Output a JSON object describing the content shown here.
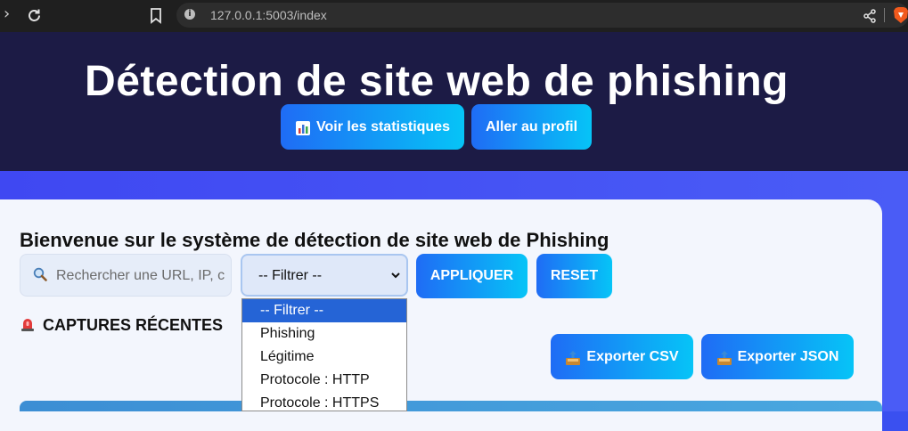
{
  "browser": {
    "url": "127.0.0.1:5003/index"
  },
  "header": {
    "title": "Détection de site web de phishing",
    "stats_button": "Voir les statistiques",
    "profile_button": "Aller au profil"
  },
  "main": {
    "welcome": "Bienvenue sur le système de détection de site web de Phishing",
    "search_placeholder": "Rechercher une URL, IP, c",
    "filter_selected": "-- Filtrer --",
    "apply_button": "APPLIQUER",
    "reset_button": "RESET",
    "section_title": "CAPTURES RÉCENTES",
    "export_csv": "Exporter CSV",
    "export_json": "Exporter JSON"
  },
  "dropdown": {
    "options": [
      "-- Filtrer --",
      "Phishing",
      "Légitime",
      "Protocole : HTTP",
      "Protocole : HTTPS"
    ]
  },
  "icons": {
    "stats": "bar-chart-icon",
    "search": "magnifier-icon",
    "section": "siren-icon",
    "export": "outbox-tray-icon"
  },
  "colors": {
    "header_bg": "#1c1b45",
    "button_start": "#1f6cf5",
    "button_end": "#06c4f7",
    "page_bg": "#3f48f2",
    "card_bg": "#f3f6fd",
    "selected_option": "#2564d6"
  }
}
